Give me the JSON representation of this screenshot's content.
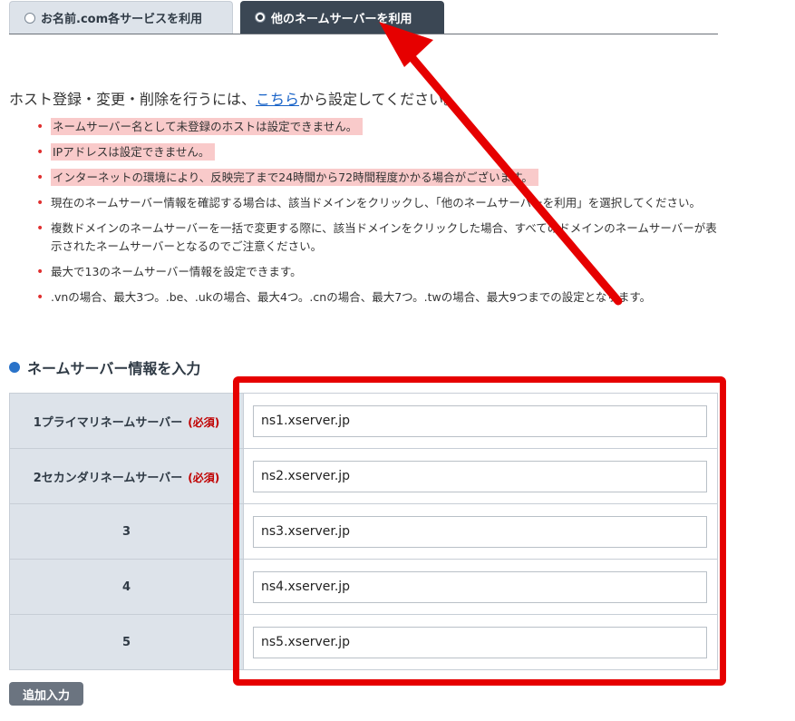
{
  "tabs": [
    {
      "label": "お名前.com各サービスを利用",
      "selected": false
    },
    {
      "label": "他のネームサーバーを利用",
      "selected": true
    }
  ],
  "intro": {
    "before": "ホスト登録・変更・削除を行うには、",
    "link": "こちら",
    "after": "から設定してください。"
  },
  "notes": [
    "ネームサーバー名として未登録のホストは設定できません。",
    "IPアドレスは設定できません。",
    "インターネットの環境により、反映完了まで24時間から72時間程度かかる場合がございます。",
    "現在のネームサーバー情報を確認する場合は、該当ドメインをクリックし、「他のネームサーバーを利用」を選択してください。",
    "複数ドメインのネームサーバーを一括で変更する際に、該当ドメインをクリックした場合、すべてのドメインのネームサーバーが表示されたネームサーバーとなるのでご注意ください。",
    "最大で13のネームサーバー情報を設定できます。",
    ".vnの場合、最大3つ。.be、.ukの場合、最大4つ。.cnの場合、最大7つ。.twの場合、最大9つまでの設定となります。"
  ],
  "section": {
    "title": "ネームサーバー情報を入力"
  },
  "nameservers": [
    {
      "label": "1プライマリネームサーバー",
      "required": "(必須)",
      "value": "ns1.xserver.jp"
    },
    {
      "label": "2セカンダリネームサーバー",
      "required": "(必須)",
      "value": "ns2.xserver.jp"
    },
    {
      "label": "3",
      "required": "",
      "value": "ns3.xserver.jp"
    },
    {
      "label": "4",
      "required": "",
      "value": "ns4.xserver.jp"
    },
    {
      "label": "5",
      "required": "",
      "value": "ns5.xserver.jp"
    }
  ],
  "add_button": "追加入力",
  "colors": {
    "highlight": "#e60000",
    "tab_active": "#3b4754",
    "tab_inactive": "#dde3ea",
    "link": "#1a64c8",
    "note_highlight": "#f9caca"
  }
}
